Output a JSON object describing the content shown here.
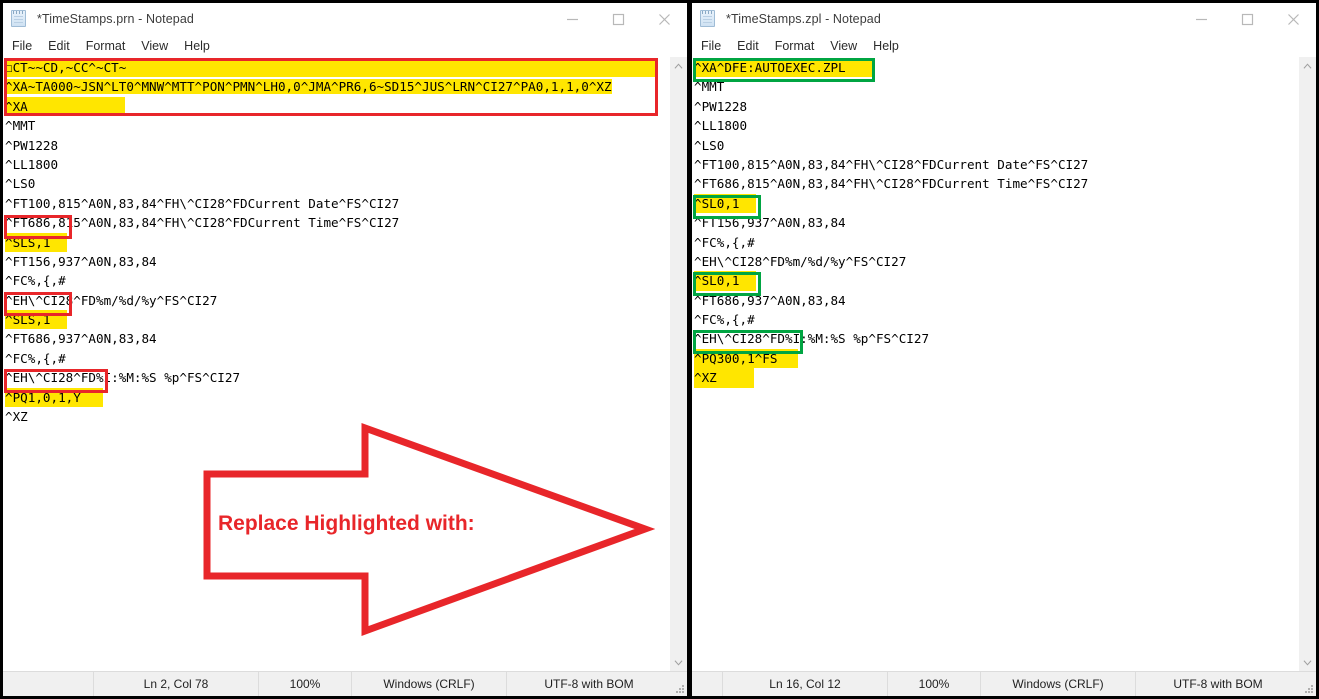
{
  "left_window": {
    "title": "*TimeStamps.prn - Notepad",
    "icon": "notepad-icon",
    "controls": {
      "minimize": "minimize-icon",
      "maximize": "maximize-icon",
      "close": "close-icon"
    },
    "menu": [
      "File",
      "Edit",
      "Format",
      "View",
      "Help"
    ],
    "lines": [
      "☐CT~~CD,~CC^~CT~",
      "^XA~TA000~JSN^LT0^MNW^MTT^PON^PMN^LH0,0^JMA^PR6,6~SD15^JUS^LRN^CI27^PA0,1,1,0^XZ",
      "^XA",
      "^MMT",
      "^PW1228",
      "^LL1800",
      "^LS0",
      "^FT100,815^A0N,83,84^FH\\^CI28^FDCurrent Date^FS^CI27",
      "^FT686,815^A0N,83,84^FH\\^CI28^FDCurrent Time^FS^CI27",
      "^SLS,1",
      "^FT156,937^A0N,83,84",
      "^FC%,{,#",
      "^EH\\^CI28^FD%m/%d/%y^FS^CI27",
      "^SLS,1",
      "^FT686,937^A0N,83,84",
      "^FC%,{,#",
      "^EH\\^CI28^FD%I:%M:%S %p^FS^CI27",
      "^PQ1,0,1,Y",
      "^XZ"
    ],
    "statusbar": {
      "position": "Ln 2, Col 78",
      "zoom": "100%",
      "line_ending": "Windows (CRLF)",
      "encoding": "UTF-8 with BOM"
    }
  },
  "right_window": {
    "title": "*TimeStamps.zpl - Notepad",
    "icon": "notepad-icon",
    "controls": {
      "minimize": "minimize-icon",
      "maximize": "maximize-icon",
      "close": "close-icon"
    },
    "menu": [
      "File",
      "Edit",
      "Format",
      "View",
      "Help"
    ],
    "lines": [
      "^XA^DFE:AUTOEXEC.ZPL",
      "^MMT",
      "^PW1228",
      "^LL1800",
      "^LS0",
      "^FT100,815^A0N,83,84^FH\\^CI28^FDCurrent Date^FS^CI27",
      "^FT686,815^A0N,83,84^FH\\^CI28^FDCurrent Time^FS^CI27",
      "^SL0,1",
      "^FT156,937^A0N,83,84",
      "^FC%,{,#",
      "^EH\\^CI28^FD%m/%d/%y^FS^CI27",
      "^SL0,1",
      "^FT686,937^A0N,83,84",
      "^FC%,{,#",
      "^EH\\^CI28^FD%I:%M:%S %p^FS^CI27",
      "^PQ300,1^FS",
      "^XZ"
    ],
    "statusbar": {
      "position": "Ln 16, Col 12",
      "zoom": "100%",
      "line_ending": "Windows (CRLF)",
      "encoding": "UTF-8 with BOM"
    }
  },
  "annotation": {
    "arrow_label": "Replace Highlighted with:",
    "red_color": "#e8262a",
    "green_color": "#00a542",
    "highlight_color": "#ffe600"
  }
}
